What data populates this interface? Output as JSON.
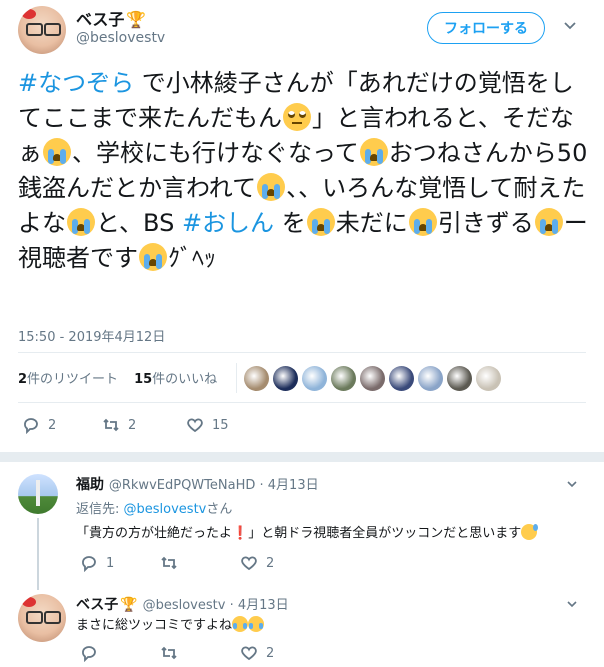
{
  "tweet": {
    "author_name": "ベス子",
    "author_handle": "@beslovestv",
    "follow_label": "フォローする",
    "text": {
      "hashtag1": "#なつぞら",
      "seg1": " で小林綾子さんが「あれだけの覚悟をしてここまで来たんだもん",
      "seg2": "」と言われると、そだなぁ",
      "seg3": "、学校にも行けなぐなって",
      "seg4": "おつねさんから50銭盗んだとか言われて",
      "seg5": "、、いろんな覚悟して耐えたよな",
      "seg6": "と、BS ",
      "hashtag2": "#おしん",
      "seg7": " を",
      "seg8": "未だに",
      "seg9": "引きずる",
      "seg10": "ー視聴者です",
      "seg11": "ｸﾞﾍｯ"
    },
    "timestamp": "15:50 - 2019年4月12日",
    "retweets_count": "2",
    "retweets_label": "件のリツイート",
    "likes_count": "15",
    "likes_label": "件のいいね",
    "actions": {
      "reply": "2",
      "retweet": "2",
      "like": "15"
    },
    "liker_colors": [
      "#a58c6f",
      "#1c2d5a",
      "#8fb4d9",
      "#6b7a5c",
      "#7a6b6b",
      "#3a4a7a",
      "#8aa4c8",
      "#5c5a52",
      "#c9c2b5"
    ]
  },
  "replies": [
    {
      "name": "福助",
      "handle": "@RkwvEdPQWTeNaHD",
      "date": "4月13日",
      "reply_to_prefix": "返信先: ",
      "reply_to_handle": "@beslovestv",
      "reply_to_suffix": "さん",
      "text_a": "「貴方の方が壮絶だったよ",
      "text_exclaim": "❗",
      "text_b": "」と朝ドラ視聴者全員がツッコンだと思います",
      "actions": {
        "reply": "1",
        "retweet": "",
        "like": "2"
      }
    },
    {
      "name": "ベス子",
      "handle": "@beslovestv",
      "date": "4月13日",
      "text": "まさに総ツッコミですよね",
      "actions": {
        "reply": "",
        "retweet": "",
        "like": "2"
      }
    }
  ],
  "icons": {
    "trophy": "🏆",
    "chevron": "⌄"
  }
}
